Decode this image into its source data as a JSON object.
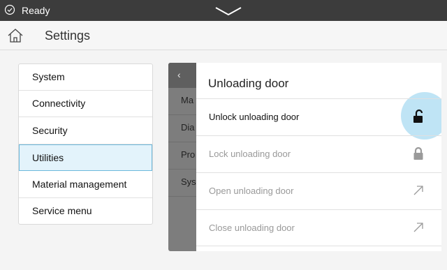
{
  "status": {
    "text": "Ready"
  },
  "header": {
    "title": "Settings"
  },
  "menu": {
    "items": [
      {
        "label": "System"
      },
      {
        "label": "Connectivity"
      },
      {
        "label": "Security"
      },
      {
        "label": "Utilities"
      },
      {
        "label": "Material management"
      },
      {
        "label": "Service menu"
      }
    ]
  },
  "back_panel": {
    "items": [
      {
        "label": "Ma"
      },
      {
        "label": "Dia"
      },
      {
        "label": "Pro"
      },
      {
        "label": "Sys"
      }
    ]
  },
  "detail": {
    "title": "Unloading door",
    "rows": [
      {
        "label": "Unlock unloading door",
        "icon": "unlock-icon",
        "enabled": true
      },
      {
        "label": "Lock unloading door",
        "icon": "lock-icon",
        "enabled": false
      },
      {
        "label": "Open unloading door",
        "icon": "arrow-up-right-icon",
        "enabled": false
      },
      {
        "label": "Close unloading door",
        "icon": "arrow-up-right-icon",
        "enabled": false
      }
    ]
  },
  "colors": {
    "accent": "#6cb8dc",
    "selected_bg": "#e3f3fb",
    "status_bar": "#3c3c3c"
  }
}
